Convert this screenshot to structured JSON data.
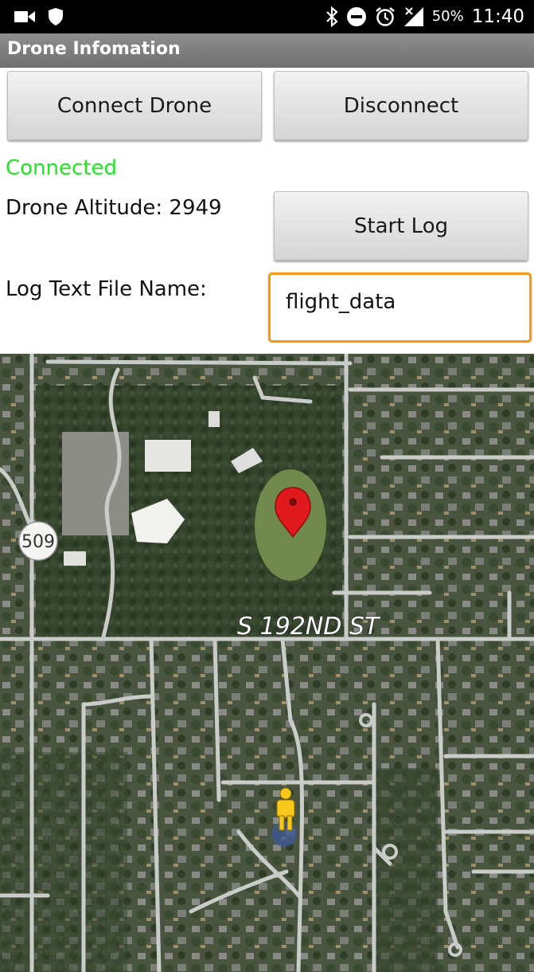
{
  "status_bar": {
    "left_icons": [
      "video-camera-icon",
      "shield-icon"
    ],
    "right_icons": [
      "bluetooth-icon",
      "do-not-disturb-icon",
      "alarm-icon",
      "signal-icon"
    ],
    "battery": "50%",
    "time": "11:40"
  },
  "app": {
    "title": "Drone Infomation"
  },
  "controls": {
    "connect_label": "Connect Drone",
    "disconnect_label": "Disconnect",
    "start_log_label": "Start Log"
  },
  "info": {
    "connection_status": "Connected",
    "altitude_text": "Drone Altitude: 2949",
    "log_name_label": "Log Text File Name:",
    "log_name_value": "flight_data"
  },
  "map": {
    "street_label": "S 192ND ST",
    "route_shield": "509",
    "marker_icon": "map-pin-icon",
    "user_icon": "pegman-icon"
  },
  "colors": {
    "connected": "#1ee81e",
    "input_focus": "#f39a1e",
    "marker": "#e0191c"
  }
}
